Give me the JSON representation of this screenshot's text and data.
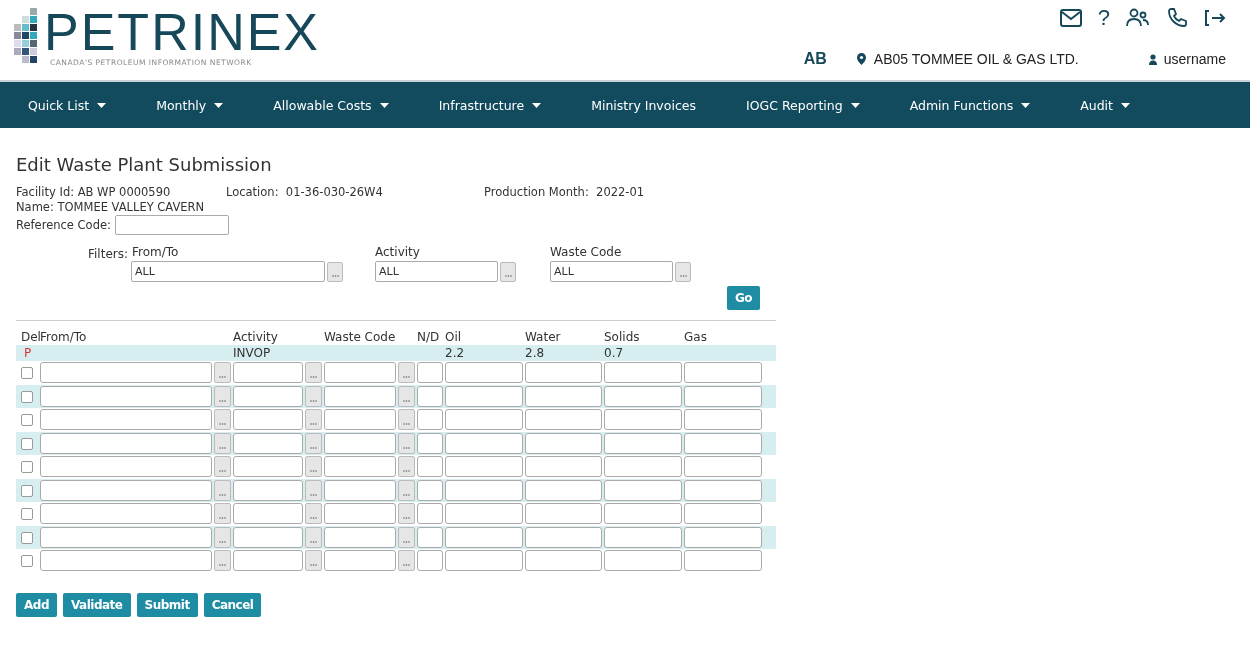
{
  "header": {
    "logo": {
      "name": "PETRINEX",
      "tagline": "CANADA'S PETROLEUM INFORMATION NETWORK"
    },
    "jurisdiction": "AB",
    "company": "AB05 TOMMEE OIL & GAS LTD.",
    "user": "username",
    "help": "?"
  },
  "nav": [
    {
      "label": "Quick List",
      "dropdown": true
    },
    {
      "label": "Monthly",
      "dropdown": true
    },
    {
      "label": "Allowable Costs",
      "dropdown": true
    },
    {
      "label": "Infrastructure",
      "dropdown": true
    },
    {
      "label": "Ministry Invoices",
      "dropdown": false
    },
    {
      "label": "IOGC Reporting",
      "dropdown": true
    },
    {
      "label": "Admin Functions",
      "dropdown": true
    },
    {
      "label": "Audit",
      "dropdown": true
    }
  ],
  "page": {
    "title": "Edit Waste Plant Submission",
    "facility_id": {
      "label": "Facility Id:",
      "value": "AB WP 0000590"
    },
    "location": {
      "label": "Location:",
      "value": "01-36-030-26W4"
    },
    "production_month": {
      "label": "Production Month:",
      "value": "2022-01"
    },
    "name": {
      "label": "Name:",
      "value": "TOMMEE VALLEY CAVERN"
    },
    "reference_code": {
      "label": "Reference Code:"
    }
  },
  "filters": {
    "label": "Filters:",
    "fields": [
      {
        "label": "From/To",
        "value": "ALL"
      },
      {
        "label": "Activity",
        "value": "ALL"
      },
      {
        "label": "Waste Code",
        "value": "ALL"
      }
    ],
    "go": "Go"
  },
  "table": {
    "columns": [
      "Del",
      "From/To",
      "Activity",
      "Waste Code",
      "N/D",
      "Oil",
      "Water",
      "Solids",
      "Gas"
    ],
    "existing_row": {
      "del": "P",
      "activity": "INVOP",
      "oil": "2.2",
      "water": "2.8",
      "solids": "0.7"
    },
    "entry_rows": [
      {
        "checked": false
      },
      {
        "checked": false
      },
      {
        "checked": false
      },
      {
        "checked": false
      },
      {
        "checked": false
      },
      {
        "checked": false
      },
      {
        "checked": false
      },
      {
        "checked": false
      },
      {
        "checked": false
      }
    ]
  },
  "buttons": [
    "Add",
    "Validate",
    "Submit",
    "Cancel"
  ]
}
